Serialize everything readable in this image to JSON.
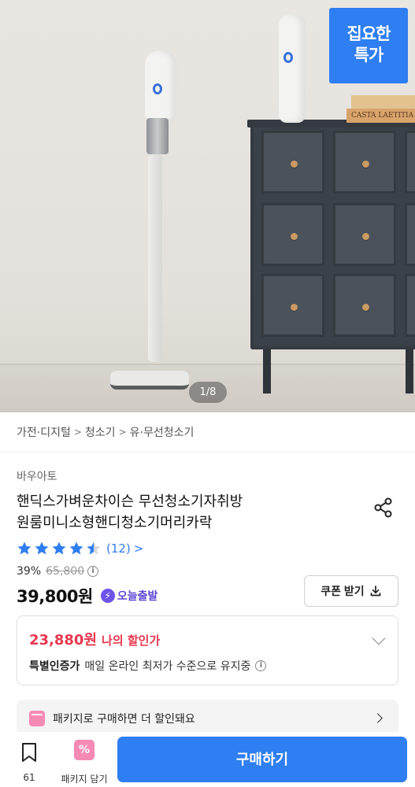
{
  "gallery": {
    "promo_badge": {
      "line1": "집요한",
      "line2": "특가"
    },
    "counter": "1/8",
    "book_spines": [
      "CASTA LAETITIA"
    ]
  },
  "breadcrumb": {
    "items": [
      "가전·디지털",
      "청소기",
      "유·무선청소기"
    ],
    "separator": ">"
  },
  "product": {
    "brand": "바우아토",
    "title_line1": "핸딕스가벼운차이슨 무선청소기자취방",
    "title_line2": "원룸미니소형핸디청소기머리카락",
    "rating": {
      "stars": 4.5,
      "count_label": "(12)",
      "chevron": ">"
    },
    "discount_rate": "39%",
    "original_price": "65,800",
    "info_icon": "i",
    "price": "39,800원",
    "today_delivery": {
      "icon": "⚡",
      "label": "오늘출발"
    }
  },
  "coupon_button": {
    "label": "쿠폰 받기",
    "icon": "download-icon"
  },
  "my_discount": {
    "amount": "23,880원",
    "label": "나의 할인가",
    "cert_label": "특별인증가",
    "description": "매일 온라인 최저가 수준으로 유지중",
    "info_icon": "i"
  },
  "package_banner": {
    "text": "패키지로 구매하면 더 할인돼요"
  },
  "bottom_bar": {
    "favorite_count": "61",
    "package_label": "패키지 담기",
    "package_icon": "%",
    "buy_label": "구매하기"
  },
  "colors": {
    "accent": "#2f7ef2",
    "discount_red": "#e8384f",
    "today_purple": "#5d45d6",
    "package_pink": "#f58ab5",
    "star_blue": "#2f7ef2"
  }
}
